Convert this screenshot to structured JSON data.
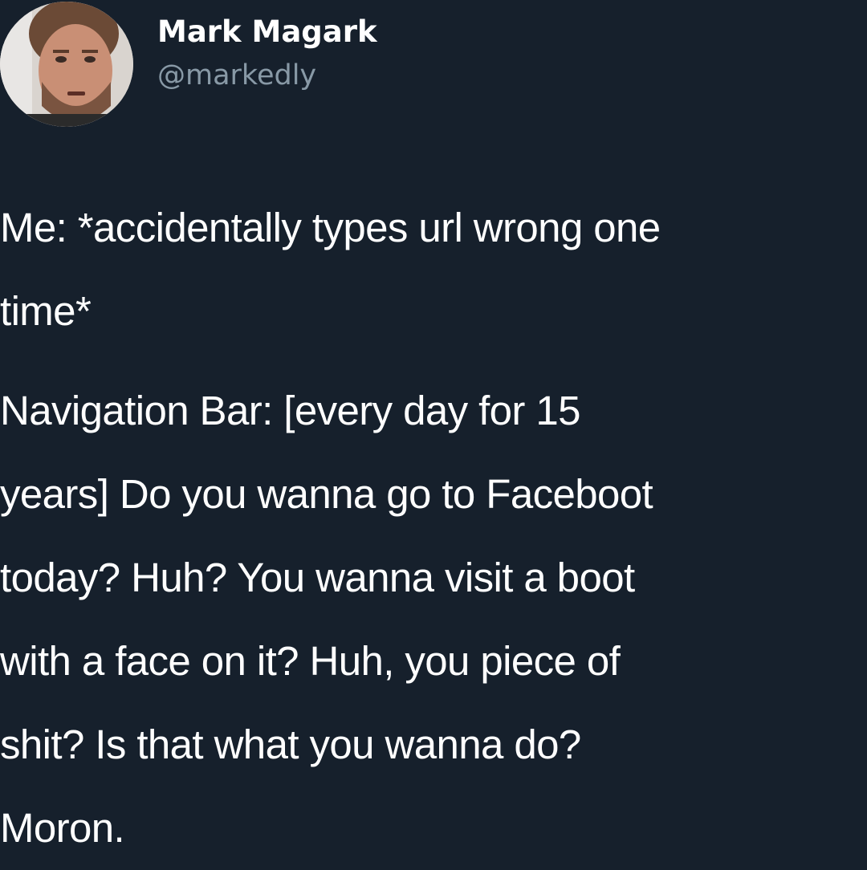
{
  "author": {
    "display_name": "Mark Magark",
    "handle": "@markedly"
  },
  "tweet": {
    "paragraphs": [
      {
        "lines": [
          "Me: *accidentally types url wrong one",
          "time*"
        ]
      },
      {
        "lines": [
          "Navigation Bar: [every day for 15",
          "years] Do you wanna go to Faceboot",
          "today? Huh? You wanna visit a boot",
          "with a face on it? Huh, you piece of",
          "shit? Is that what you wanna do?",
          "Moron."
        ]
      }
    ]
  },
  "colors": {
    "background": "#16202c",
    "text": "#ffffff",
    "handle": "#8899a6"
  }
}
